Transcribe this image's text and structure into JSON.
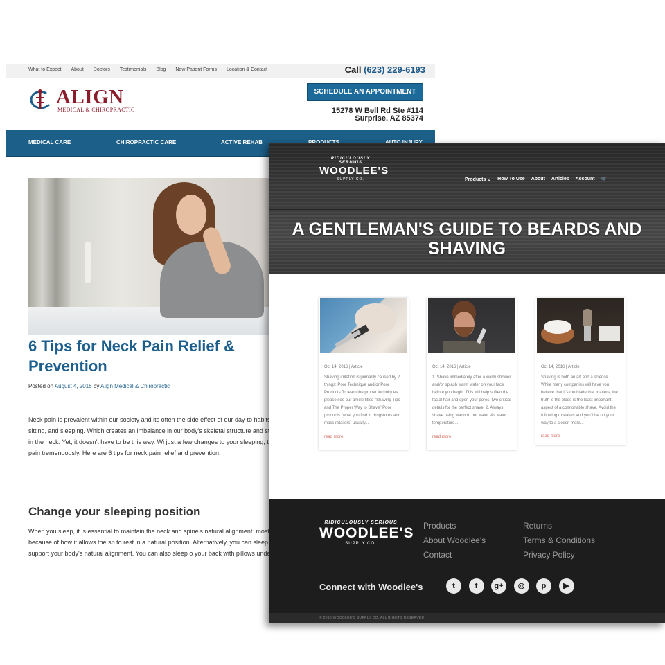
{
  "align": {
    "topnav": [
      "What to Expect",
      "About",
      "Doctors",
      "Testimonials",
      "Blog",
      "New Patient Forms",
      "Location & Contact"
    ],
    "call_label": "Call",
    "phone": "(623) 229-6193",
    "logo_text": "ALIGN",
    "logo_sub": "MEDICAL & CHIROPRACTIC",
    "schedule_button": "SCHEDULE AN APPOINTMENT",
    "address_line1": "15278 W Bell Rd Ste #114",
    "address_line2": "Surprise, AZ 85374",
    "mainnav": [
      "MEDICAL CARE",
      "CHIROPRACTIC CARE",
      "ACTIVE REHAB",
      "PRODUCTS",
      "AUTO INJURY"
    ],
    "post_title": "6 Tips for Neck Pain Relief & Prevention",
    "posted_on": "Posted on",
    "post_date": "August 4, 2016",
    "by": "by",
    "author": "Align Medical & Chiropractic",
    "intro": "Neck pain is prevalent within our society and its often the side effect of our day-to habits. Every day we spend an exuberant time texting, sitting, and sleeping. Which creates an imbalance in our body's skeletal structure and strains our necks. This results in bad posture and pain in the neck. Yet, it doesn't have to be this way. Wi just a few changes to your sleeping, texting, and workplace habits you could reduc neck pain tremendously. Here are 6 tips for neck pain relief and prevention.",
    "section_heading": "Change your sleeping position",
    "section_body": "When you sleep, it is essential to maintain the neck and spine's natural alignment. most, sleeping on your back can reduce neck pain because of how it allows the sp to rest in a natural position. Alternatively, you can sleep on your side with a pillow between your legs to support your body's natural alignment. You can also sleep o your back with pillows under your arms to reduce any strain on the neck."
  },
  "woodlee": {
    "logo_arc": "RIDICULOUSLY SERIOUS",
    "logo_name": "WOODLEE'S",
    "logo_supply": "SUPPLY CO.",
    "nav": [
      "Products ⌄",
      "How To Use",
      "About",
      "Articles",
      "Account",
      "🛒"
    ],
    "headline": "A GENTLEMAN'S GUIDE TO BEARDS AND SHAVING",
    "cards": [
      {
        "meta": "Oct 14, 2016 | Article",
        "excerpt": "Shaving irritation is primarily caused by 2 things: Poor Technique and/or Poor Products.To learn the proper techniques please see our article titled \"Shaving Tips and The Proper Way to Shave\" Poor products (what you find in drugstores and mass retailers) usually...",
        "more": "read more"
      },
      {
        "meta": "Oct 14, 2016 | Article",
        "excerpt": "1. Shave immediately after a warm shower and/or splash warm water on your face before you begin. This will help soften the facial hair and open your pores, two critical details for the perfect shave. 2. Always shave using warm to hot water. As water temperature...",
        "more": "read more"
      },
      {
        "meta": "Oct 14, 2016 | Article",
        "excerpt": "Shaving is both an art and a science. While many companies will have you believe that it's the blade that matters, the truth is the blade is the least important aspect of a comfortable shave. Avoid the following mistakes and you'll be on your way to a closer, more...",
        "more": "read more"
      }
    ],
    "footer_col1": [
      "Products",
      "About Woodlee's",
      "Contact"
    ],
    "footer_col2": [
      "Returns",
      "Terms & Conditions",
      "Privacy Policy"
    ],
    "connect": "Connect with Woodlee's",
    "socials": [
      "twitter-icon",
      "facebook-icon",
      "google-plus-icon",
      "instagram-icon",
      "pinterest-icon",
      "youtube-icon"
    ],
    "copyright": "© 2016 WOODLEE'S SUPPLY CO. ALL RIGHTS RESERVED."
  },
  "colors": {
    "align_blue": "#1c5f88",
    "align_red": "#8b1c2b",
    "woodlee_dark": "#1d1d1d",
    "woodlee_link": "#d36a5f"
  }
}
